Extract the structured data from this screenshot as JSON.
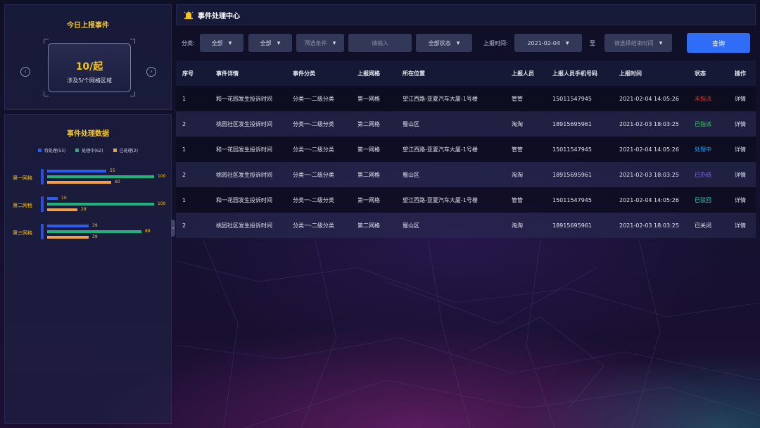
{
  "left_top": {
    "title": "今日上报事件",
    "count": "10/起",
    "subtitle": "涉及5/个网格区域"
  },
  "left_mid": {
    "title": "事件处理数据",
    "legend": [
      {
        "label": "待处理(53)",
        "color": "#2b5ef0"
      },
      {
        "label": "处理中(62)",
        "color": "#1fb37a"
      },
      {
        "label": "已处理(2)",
        "color": "#f0a049"
      }
    ],
    "grids": [
      {
        "name": "第一网格",
        "values": [
          55,
          100,
          60
        ]
      },
      {
        "name": "第二网格",
        "values": [
          10,
          100,
          28
        ]
      },
      {
        "name": "第三网格",
        "values": [
          39,
          88,
          39
        ]
      }
    ],
    "max_value": 100
  },
  "main": {
    "title": "事件处理中心",
    "filters": {
      "category_label": "分类:",
      "select1": "全部",
      "select2": "全部",
      "select3_placeholder": "筛选条件",
      "input_placeholder": "请输入",
      "status_select": "全部状态",
      "date_label": "上报时间:",
      "start_date": "2021-02-04",
      "to_label": "至",
      "end_date_placeholder": "请选择结束时间",
      "query_button": "查询"
    },
    "table": {
      "headers": [
        "序号",
        "事件详情",
        "事件分类",
        "上报网格",
        "所在位置",
        "上报人员",
        "上报人员手机号码",
        "上报时间",
        "状态",
        "操作"
      ],
      "rows": [
        {
          "no": "1",
          "detail": "和一花园发生投诉时间",
          "category": "分类一-二级分类",
          "grid": "第一网格",
          "location": "望江西路-亚夏汽车大厦-1号楼",
          "reporter": "管管",
          "phone": "15011547945",
          "time": "2021-02-04 14:05:26",
          "status": "未指派",
          "status_color": "#e0352b",
          "action": "详情"
        },
        {
          "no": "2",
          "detail": "桃园社区发生投诉时间",
          "category": "分类一-二级分类",
          "grid": "第二网格",
          "location": "蜀山区",
          "reporter": "淘淘",
          "phone": "18915695961",
          "time": "2021-02-03 18:03:25",
          "status": "已指派",
          "status_color": "#2fd45a",
          "action": "详情"
        },
        {
          "no": "1",
          "detail": "和一花园发生投诉时间",
          "category": "分类一-二级分类",
          "grid": "第一网格",
          "location": "望江西路-亚夏汽车大厦-1号楼",
          "reporter": "管管",
          "phone": "15011547945",
          "time": "2021-02-04 14:05:26",
          "status": "处理中",
          "status_color": "#2f9df0",
          "action": "详情"
        },
        {
          "no": "2",
          "detail": "桃园社区发生投诉时间",
          "category": "分类一-二级分类",
          "grid": "第二网格",
          "location": "蜀山区",
          "reporter": "淘淘",
          "phone": "18915695961",
          "time": "2021-02-03 18:03:25",
          "status": "已办结",
          "status_color": "#8a6cf0",
          "action": "详情"
        },
        {
          "no": "1",
          "detail": "和一花园发生投诉时间",
          "category": "分类一-二级分类",
          "grid": "第一网格",
          "location": "望江西路-亚夏汽车大厦-1号楼",
          "reporter": "管管",
          "phone": "15011547945",
          "time": "2021-02-04 14:05:26",
          "status": "已驳回",
          "status_color": "#2fd4c2",
          "action": "详情"
        },
        {
          "no": "2",
          "detail": "桃园社区发生投诉时间",
          "category": "分类一-二级分类",
          "grid": "第二网格",
          "location": "蜀山区",
          "reporter": "淘淘",
          "phone": "18915695961",
          "time": "2021-02-03 18:03:25",
          "status": "已关闭",
          "status_color": "#e4e7f2",
          "action": "详情"
        }
      ]
    }
  }
}
